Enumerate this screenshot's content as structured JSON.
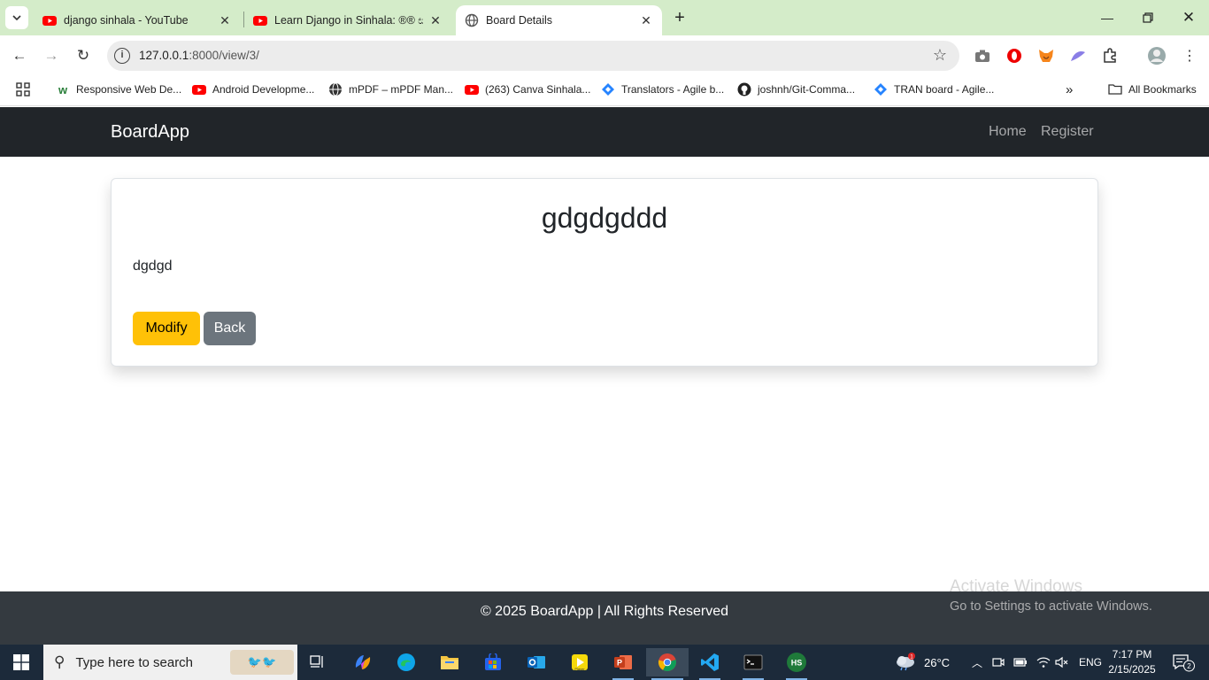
{
  "browser": {
    "tabs": [
      {
        "title": "django sinhala - YouTube",
        "icon": "youtube-icon"
      },
      {
        "title": "Learn Django in Sinhala: ®® ස",
        "icon": "youtube-icon"
      },
      {
        "title": "Board Details",
        "icon": "globe-icon",
        "active": true
      }
    ],
    "url_host": "127.0.0.1",
    "url_path": ":8000/view/3/",
    "bookmarks": [
      {
        "label": "Responsive Web De...",
        "icon": "w-icon"
      },
      {
        "label": "Android Developme...",
        "icon": "youtube-icon"
      },
      {
        "label": "mPDF – mPDF Man...",
        "icon": "globe-icon"
      },
      {
        "label": "(263) Canva Sinhala...",
        "icon": "youtube-icon"
      },
      {
        "label": "Translators - Agile b...",
        "icon": "jira-icon"
      },
      {
        "label": "joshnh/Git-Comma...",
        "icon": "github-icon"
      },
      {
        "label": "TRAN board - Agile...",
        "icon": "jira-icon"
      }
    ],
    "all_bookmarks": "All Bookmarks"
  },
  "page": {
    "brand": "BoardApp",
    "nav": {
      "home": "Home",
      "register": "Register"
    },
    "card": {
      "title": "gdgdgddd",
      "content": "dgdgd",
      "modify_label": "Modify",
      "back_label": "Back"
    },
    "footer": "© 2025 BoardApp | All Rights Reserved"
  },
  "watermark": {
    "line1": "Activate Windows",
    "line2": "Go to Settings to activate Windows."
  },
  "taskbar": {
    "search_placeholder": "Type here to search",
    "weather": "26°C",
    "language": "ENG",
    "time": "7:17 PM",
    "date": "2/15/2025",
    "notifications": "2",
    "weather_badge": "1"
  },
  "colors": {
    "navbar_bg": "#212529",
    "modify_btn": "#ffc107",
    "back_btn": "#6c757d",
    "footer_bg": "#343a40",
    "tabstrip_bg": "#d4ecc9"
  }
}
